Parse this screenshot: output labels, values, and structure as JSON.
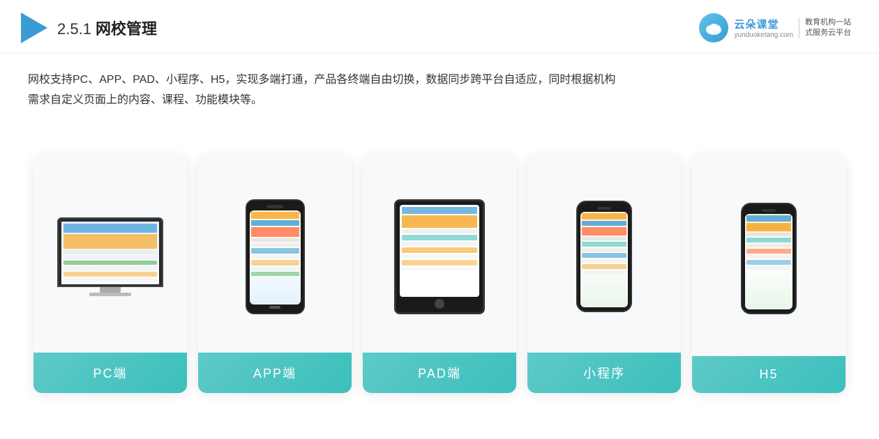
{
  "header": {
    "section_number": "2.5.1",
    "title_plain": "2.5.1 ",
    "title_bold": "网校管理",
    "brand": {
      "name": "云朵课堂",
      "url": "yunduoketang.com",
      "slogan_line1": "教育机构一站",
      "slogan_line2": "式服务云平台"
    }
  },
  "description": {
    "line1": "网校支持PC、APP、PAD、小程序、H5，实现多端打通，产品各终端自由切换，数据同步跨平台自适应，同时根据机构",
    "line2": "需求自定义页面上的内容、课程、功能模块等。"
  },
  "cards": [
    {
      "id": "pc",
      "label": "PC端"
    },
    {
      "id": "app",
      "label": "APP端"
    },
    {
      "id": "pad",
      "label": "PAD端"
    },
    {
      "id": "miniprogram",
      "label": "小程序"
    },
    {
      "id": "h5",
      "label": "H5"
    }
  ]
}
